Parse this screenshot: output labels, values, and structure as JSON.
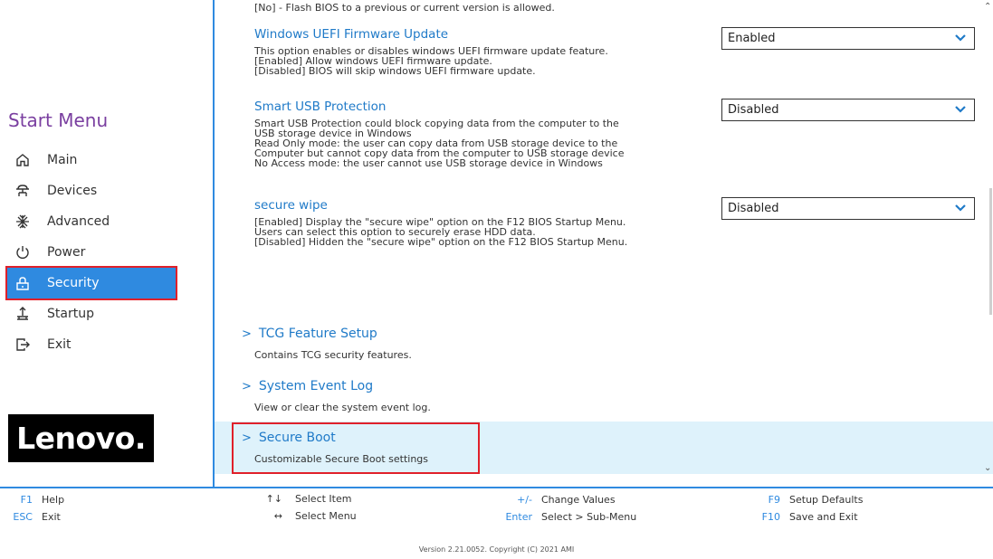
{
  "sidebar": {
    "title": "Start Menu",
    "items": [
      {
        "label": "Main",
        "icon": "home-icon"
      },
      {
        "label": "Devices",
        "icon": "devices-icon"
      },
      {
        "label": "Advanced",
        "icon": "advanced-icon"
      },
      {
        "label": "Power",
        "icon": "power-icon"
      },
      {
        "label": "Security",
        "icon": "lock-icon",
        "active": true
      },
      {
        "label": "Startup",
        "icon": "startup-icon"
      },
      {
        "label": "Exit",
        "icon": "exit-icon"
      }
    ],
    "logo": "Lenovo."
  },
  "main": {
    "clipped_text": "[No] - Flash BIOS to a previous  or current version is allowed.",
    "settings": [
      {
        "title": "Windows UEFI Firmware Update",
        "desc": [
          "This option enables or disables windows UEFI firmware  update feature.",
          "[Enabled] Allow windows UEFI firmware update.",
          "[Disabled] BIOS will skip windows UEFI firmware update."
        ],
        "value": "Enabled"
      },
      {
        "title": "Smart USB Protection",
        "desc": [
          "Smart USB Protection could block copying data from the computer to the",
          "USB storage device in Windows",
          "Read Only mode: the user can copy data from USB storage device to the",
          "Computer but cannot copy data from the computer to USB storage device",
          "No Access mode: the user cannot use USB storage device in Windows"
        ],
        "value": "Disabled"
      },
      {
        "title": "secure wipe",
        "desc": [
          "[Enabled] Display the \"secure wipe\" option on the  F12 BIOS Startup Menu.",
          "Users can select this option to securely erase HDD data.",
          "[Disabled] Hidden the \"secure wipe\" option on the F12 BIOS Startup Menu."
        ],
        "value": "Disabled"
      }
    ],
    "submenus": [
      {
        "title": "TCG Feature Setup",
        "desc": "Contains TCG security features."
      },
      {
        "title": "System Event Log",
        "desc": "View or clear the system event log."
      },
      {
        "title": "Secure Boot",
        "desc": "Customizable Secure Boot settings"
      }
    ]
  },
  "footer": {
    "keys": [
      {
        "key": "F1",
        "desc": "Help"
      },
      {
        "key": "ESC",
        "desc": "Exit"
      },
      {
        "key": "↑↓",
        "desc": "Select Item"
      },
      {
        "key": "↔",
        "desc": "Select Menu"
      },
      {
        "key": "+/-",
        "desc": "Change Values"
      },
      {
        "key": "Enter",
        "desc": "Select > Sub-Menu"
      },
      {
        "key": "F9",
        "desc": "Setup Defaults"
      },
      {
        "key": "F10",
        "desc": "Save and Exit"
      }
    ],
    "version": "Version 2.21.0052. Copyright (C) 2021 AMI"
  },
  "colors": {
    "accent": "#2f8ae0",
    "title_purple": "#7a3fa0",
    "link_blue": "#1f7ac8",
    "highlight_red": "#e0202a",
    "row_highlight": "#def2fb"
  }
}
